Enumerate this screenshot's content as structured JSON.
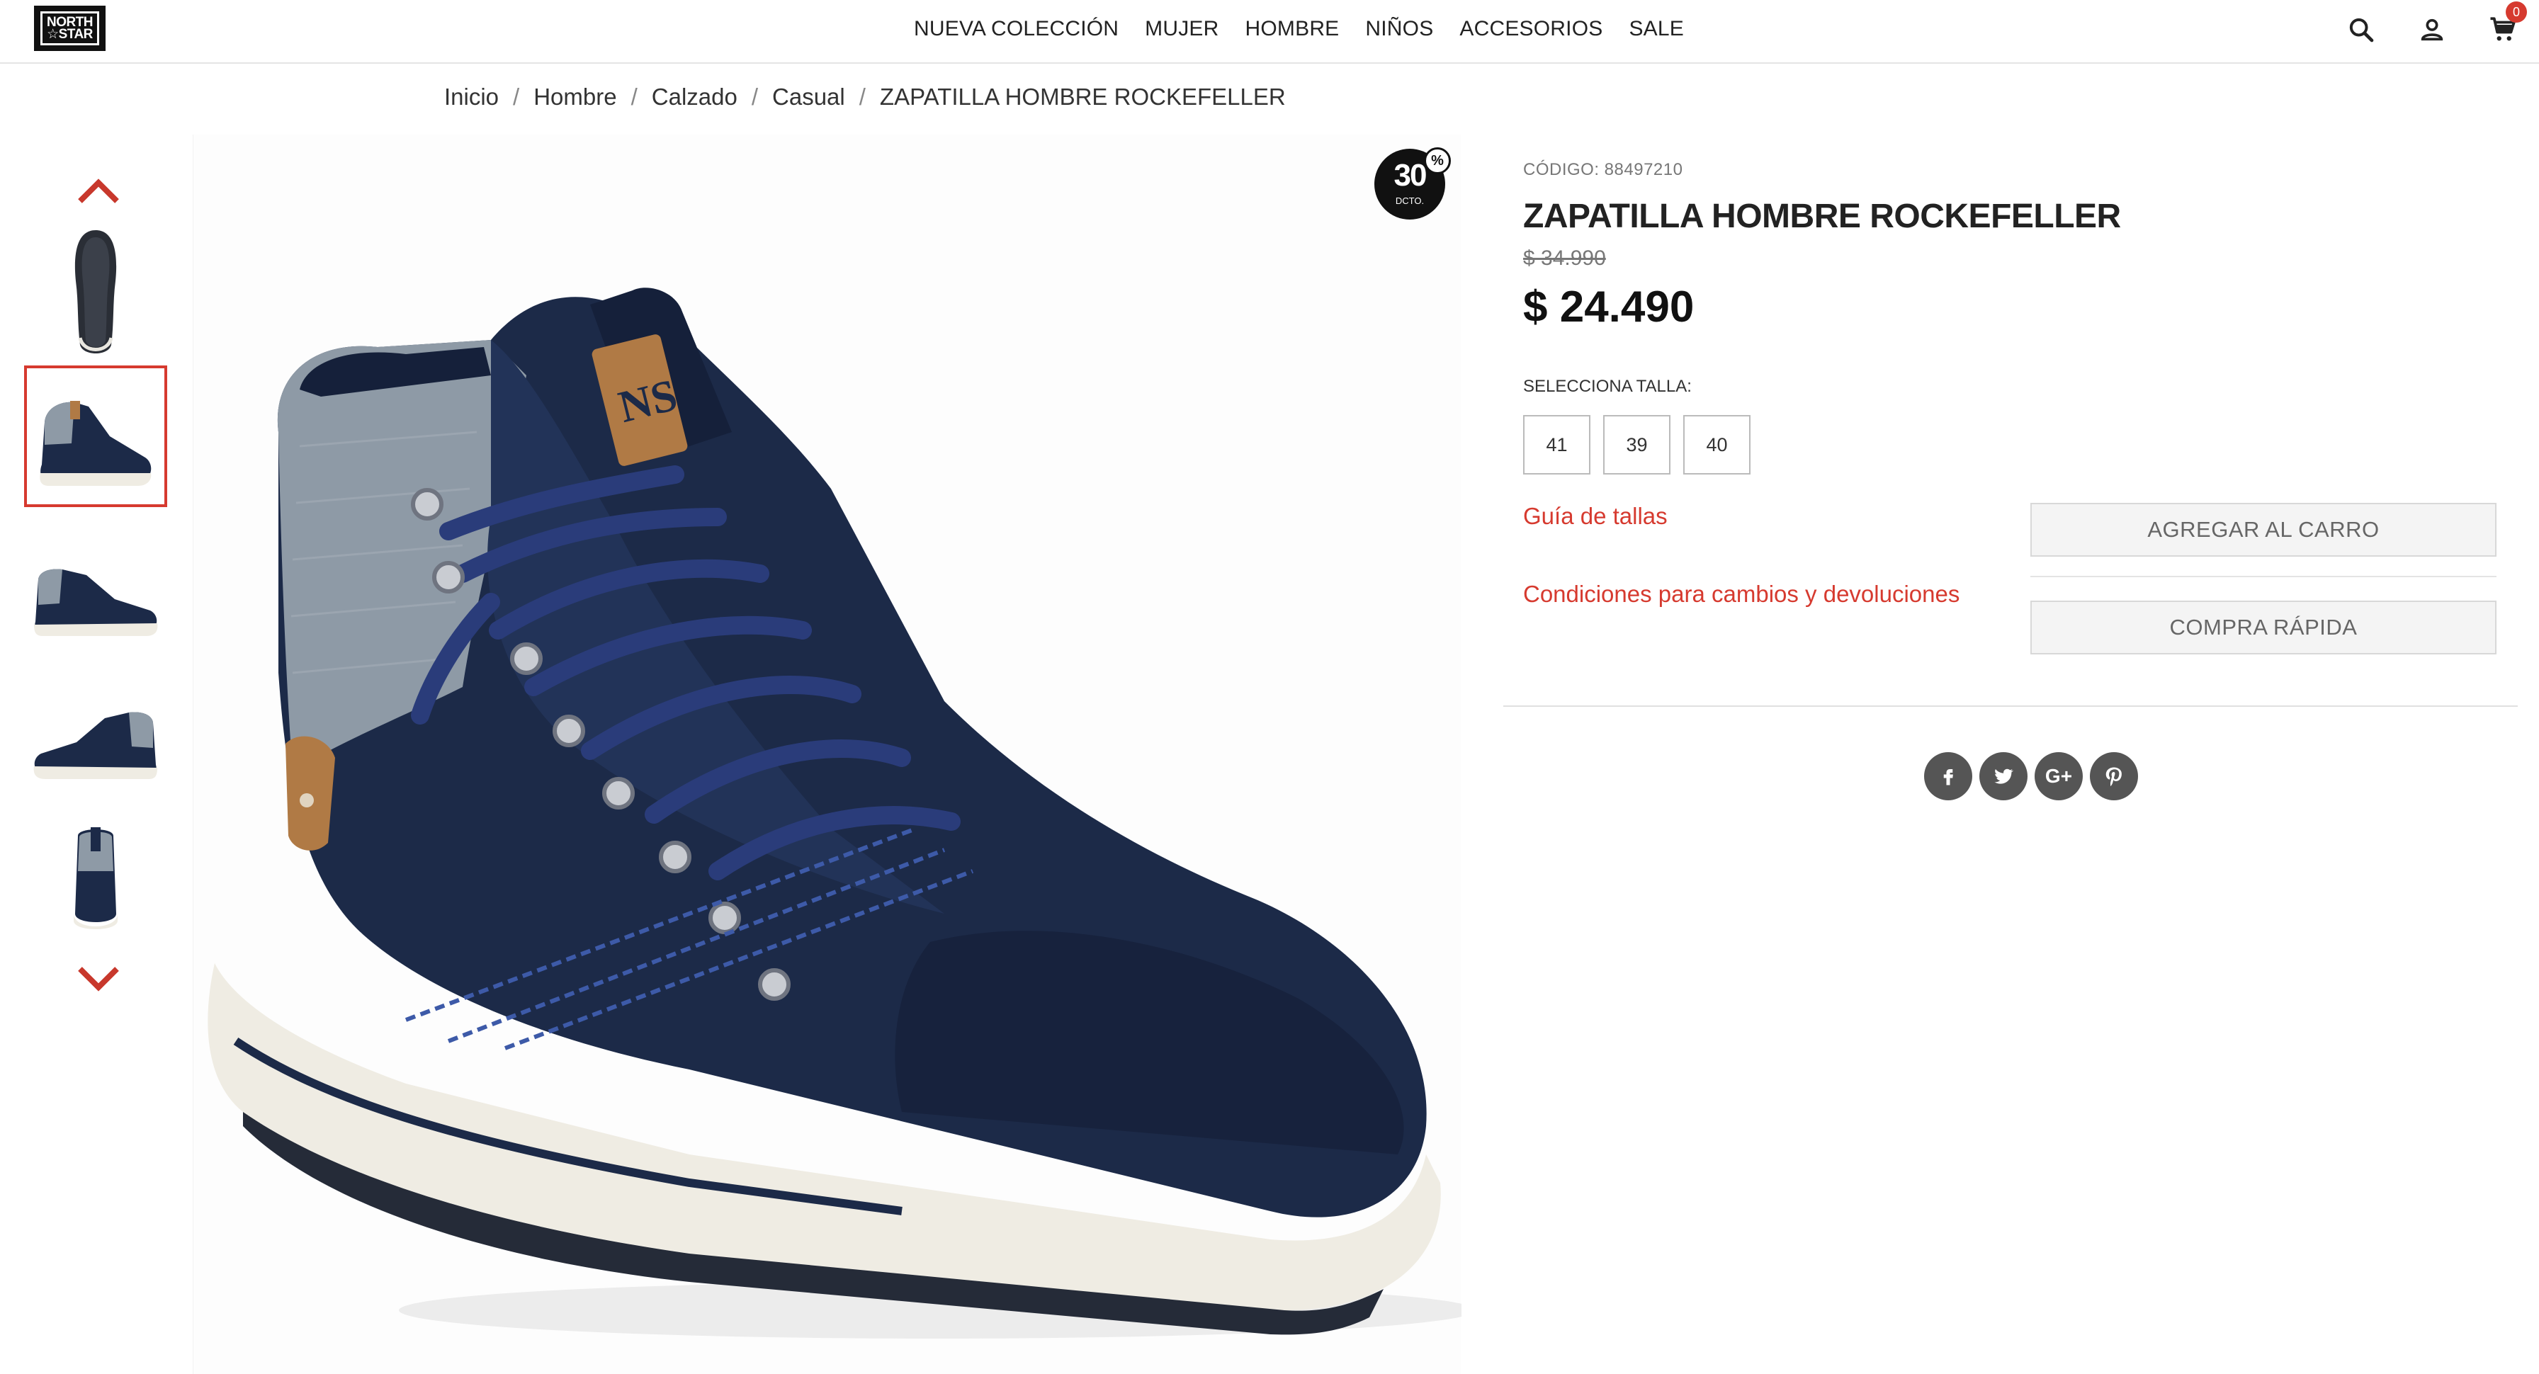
{
  "brand": {
    "logo_line1": "NORTH",
    "logo_line2": "☆STAR"
  },
  "nav": {
    "items": [
      {
        "label": "NUEVA COLECCIÓN"
      },
      {
        "label": "MUJER"
      },
      {
        "label": "HOMBRE"
      },
      {
        "label": "NIÑOS"
      },
      {
        "label": "ACCESORIOS"
      },
      {
        "label": "SALE"
      }
    ],
    "cart_count": "0",
    "icons": [
      "search-icon",
      "user-icon",
      "cart-icon"
    ]
  },
  "breadcrumb": {
    "items": [
      "Inicio",
      "Hombre",
      "Calzado",
      "Casual",
      "ZAPATILLA HOMBRE ROCKEFELLER"
    ],
    "separator": "/"
  },
  "gallery": {
    "thumbnails": [
      "sole-view",
      "side-view",
      "outer-side-view",
      "inner-side-view",
      "back-view"
    ],
    "active_index": 1
  },
  "discount": {
    "value": "30",
    "label": "DCTO.",
    "symbol": "%"
  },
  "product": {
    "code": "CÓDIGO: 88497210",
    "title": "ZAPATILLA HOMBRE ROCKEFELLER",
    "old_price": "$ 34.990",
    "price": "$ 24.490",
    "size_label": "SELECCIONA TALLA:",
    "sizes": [
      "41",
      "39",
      "40"
    ],
    "size_guide": "Guía de tallas",
    "returns_link": "Condiciones para cambios y devoluciones",
    "add_to_cart": "AGREGAR AL CARRO",
    "quick_buy": "COMPRA RÁPIDA"
  },
  "share": [
    {
      "network": "facebook",
      "glyph": "f"
    },
    {
      "network": "twitter",
      "glyph": "t"
    },
    {
      "network": "google-plus",
      "glyph": "G+"
    },
    {
      "network": "pinterest",
      "glyph": "P"
    }
  ],
  "colors": {
    "accent": "#d63a2f",
    "shoe_navy": "#1c2a48",
    "canvas_gray": "#8e9aa6",
    "leather_tan": "#b07a45",
    "sole_cream": "#efece3"
  }
}
